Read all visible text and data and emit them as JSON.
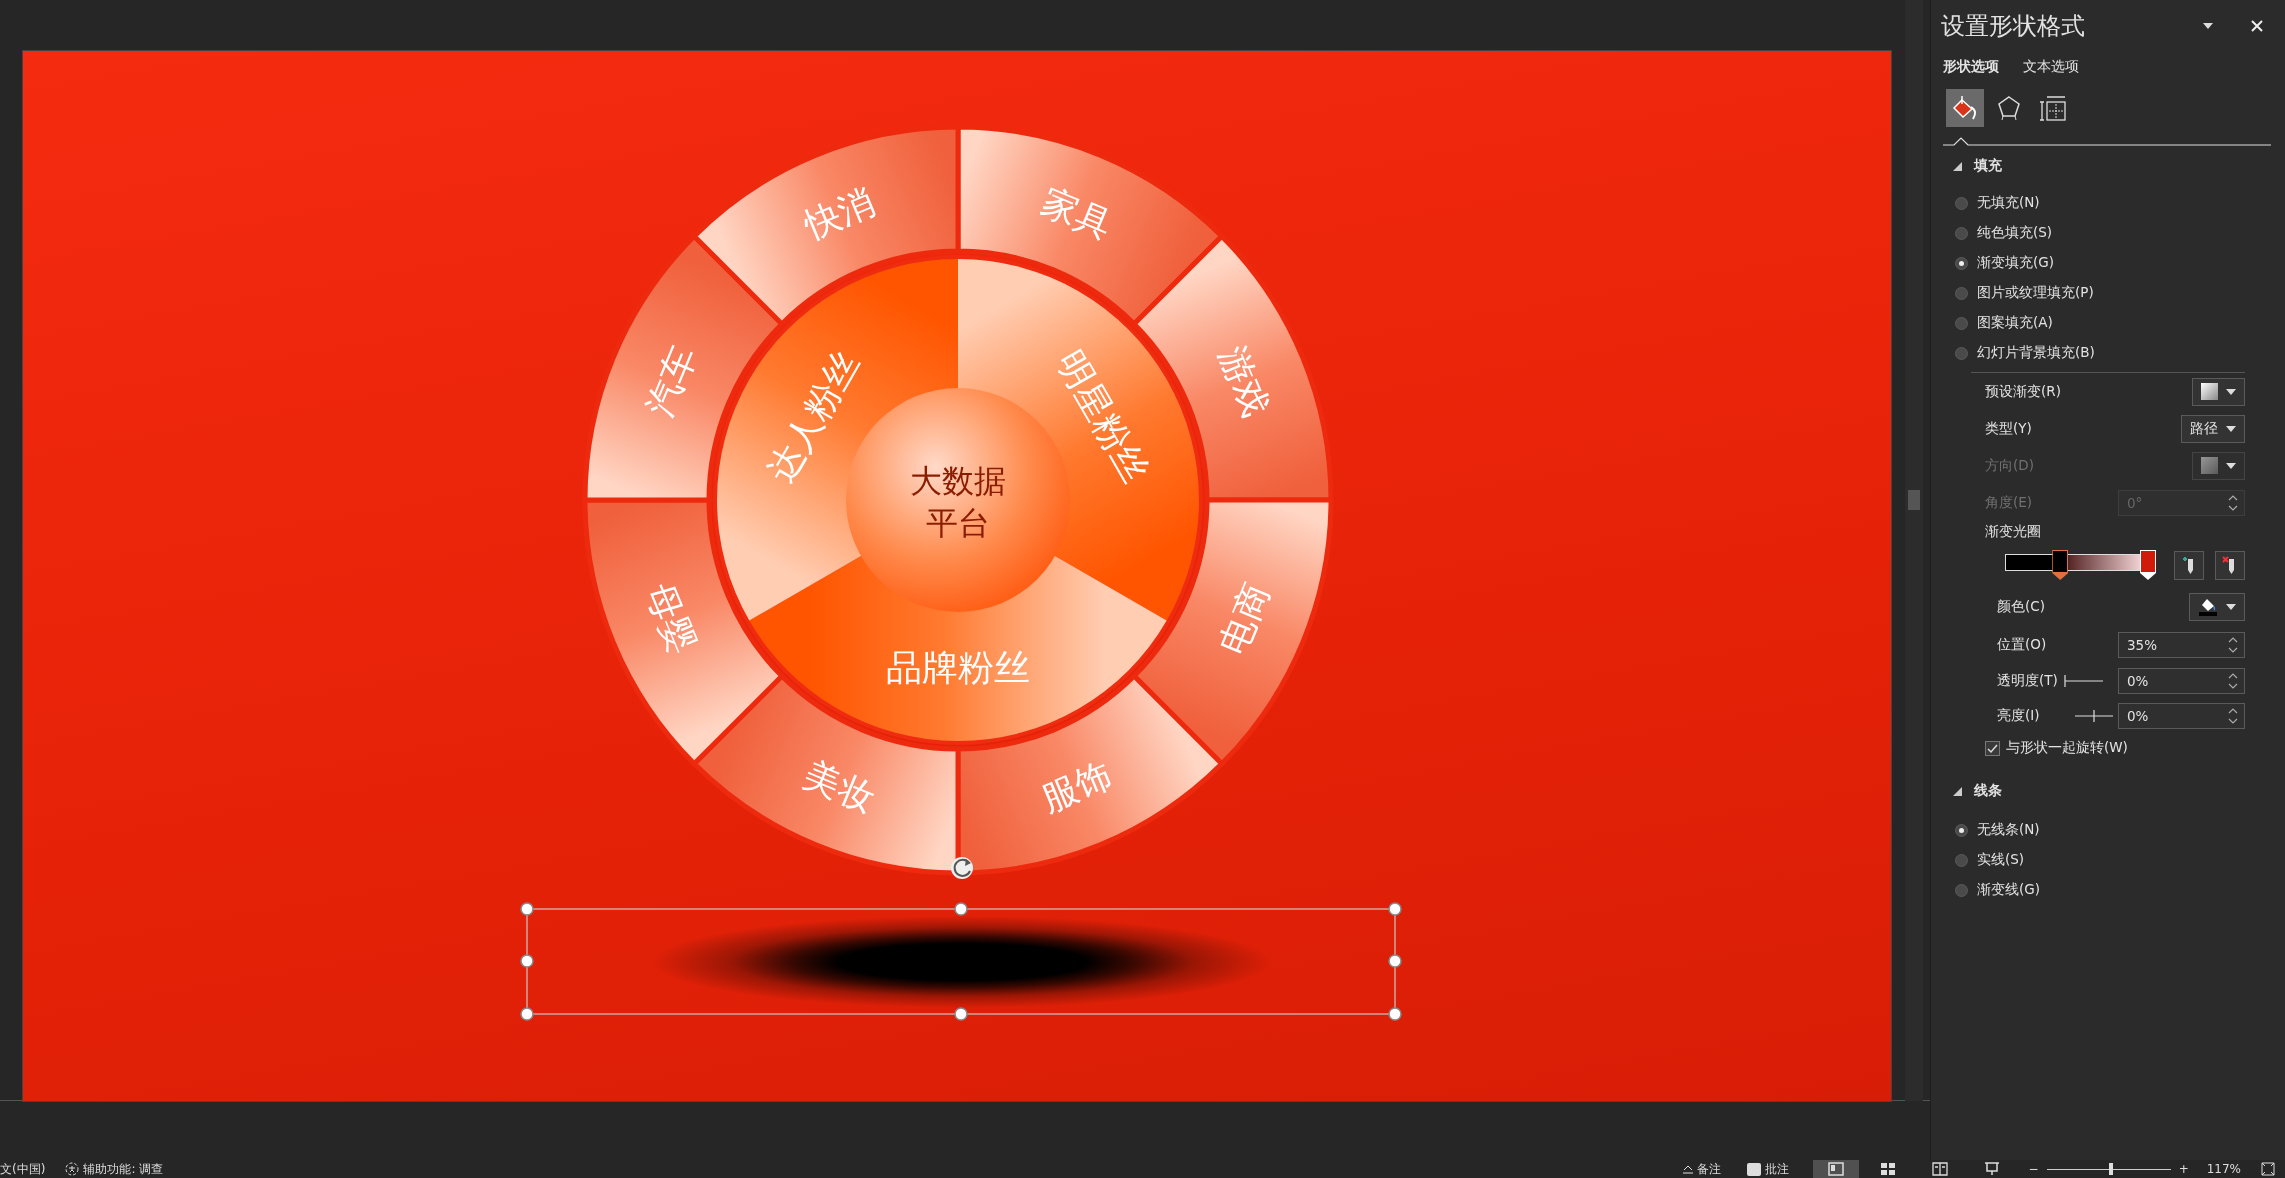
{
  "slide": {
    "outer_segments": [
      "家具",
      "游戏",
      "电商",
      "服饰",
      "美妆",
      "母婴",
      "汽车",
      "快消"
    ],
    "inner_segments": [
      "明星粉丝",
      "品牌粉丝",
      "达人粉丝"
    ],
    "center_lines": [
      "大数据",
      "平台"
    ],
    "shadow": {
      "selected": true
    }
  },
  "panel": {
    "title": "设置形状格式",
    "tabs": [
      {
        "label": "形状选项",
        "selected": true
      },
      {
        "label": "文本选项",
        "selected": false
      }
    ],
    "icon_tabs": [
      {
        "kind": "fill",
        "selected": true
      },
      {
        "kind": "effects",
        "selected": false
      },
      {
        "kind": "size",
        "selected": false
      }
    ],
    "fill": {
      "title": "填充",
      "expanded": true,
      "options": [
        {
          "label": "无填充(N)",
          "selected": false
        },
        {
          "label": "纯色填充(S)",
          "selected": false
        },
        {
          "label": "渐变填充(G)",
          "selected": true
        },
        {
          "label": "图片或纹理填充(P)",
          "selected": false
        },
        {
          "label": "图案填充(A)",
          "selected": false
        },
        {
          "label": "幻灯片背景填充(B)",
          "selected": false
        }
      ],
      "preset": {
        "label": "预设渐变(R)"
      },
      "type": {
        "label": "类型(Y)",
        "value": "路径"
      },
      "direction": {
        "label": "方向(D)",
        "disabled": true
      },
      "angle": {
        "label": "角度(E)",
        "value": "0°",
        "disabled": true
      },
      "stops": {
        "label": "渐变光圈",
        "items": [
          {
            "color": "#000000",
            "level": 0.35,
            "selected": true
          },
          {
            "color": "#d01a0a",
            "level": 1,
            "selected": false
          }
        ]
      },
      "color": {
        "label": "颜色(C)"
      },
      "position": {
        "label": "位置(O)",
        "value": "35%"
      },
      "transparency": {
        "label": "透明度(T)",
        "value": "0%"
      },
      "brightness": {
        "label": "亮度(I)",
        "value": "0%"
      },
      "rotate": {
        "label": "与形状一起旋转(W)",
        "checked": true
      }
    },
    "line": {
      "title": "线条",
      "expanded": true,
      "options": [
        {
          "label": "无线条(N)",
          "selected": true
        },
        {
          "label": "实线(S)",
          "selected": false
        },
        {
          "label": "渐变线(G)",
          "selected": false
        }
      ]
    }
  },
  "status_bar": {
    "language": "文(中国)",
    "accessibility": "辅助功能: 调查",
    "notes": "备注",
    "comments": "批注",
    "views": [
      {
        "kind": "normal",
        "selected": true
      },
      {
        "kind": "sorter",
        "selected": false
      },
      {
        "kind": "reading",
        "selected": false
      },
      {
        "kind": "slideshow",
        "selected": false
      }
    ],
    "zoom_out": "−",
    "zoom": {
      "level": 0.52
    },
    "zoom_in": "+",
    "zoom_value": "117%"
  }
}
